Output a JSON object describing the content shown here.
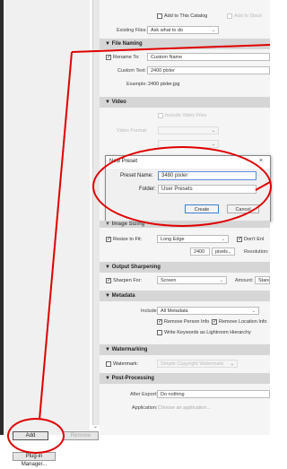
{
  "file_settings": {
    "add_catalog_label": "Add to This Catalog",
    "add_stack_label": "Add to Stack",
    "existing_files_label": "Existing Files:",
    "existing_files_value": "Ask what to do"
  },
  "file_naming": {
    "header": "File Naming",
    "rename_label": "Rename To:",
    "rename_value": "Custom Name",
    "custom_text_label": "Custom Text:",
    "custom_text_value": "2400 pixler",
    "example_label": "Example:",
    "example_value": "2400 pixler.jpg"
  },
  "video": {
    "header": "Video",
    "include_label": "Include Video Files",
    "format_label": "Video Format:"
  },
  "dialog": {
    "title": "New Preset",
    "close": "×",
    "preset_name_label": "Preset Name:",
    "preset_name_value": "3480 pixler",
    "folder_label": "Folder:",
    "folder_value": "User Presets",
    "create": "Create",
    "cancel": "Cancel"
  },
  "image_sizing": {
    "header": "Image Sizing",
    "resize_label": "Resize to Fit:",
    "resize_value": "Long Edge",
    "dont_enlarge": "Don't Enl",
    "size_value": "2400",
    "unit_value": "pixels",
    "resolution_label": "Resolution:"
  },
  "output_sharpening": {
    "header": "Output Sharpening",
    "sharpen_label": "Sharpen For:",
    "sharpen_value": "Screen",
    "amount_label": "Amount:",
    "amount_value": "Stand"
  },
  "metadata": {
    "header": "Metadata",
    "include_label": "Include:",
    "include_value": "All Metadata",
    "remove_person": "Remove Person Info",
    "remove_location": "Remove Location Info",
    "write_keywords": "Write Keywords as Lightroom Hierarchy"
  },
  "watermarking": {
    "header": "Watermarking",
    "watermark_label": "Watermark:",
    "watermark_value": "Simple Copyright Watermark"
  },
  "post_processing": {
    "header": "Post-Processing",
    "after_export_label": "After Export:",
    "after_export_value": "Do nothing",
    "application_label": "Application:",
    "application_value": "Choose an application..."
  },
  "bottom": {
    "add": "Add",
    "remove": "Remove",
    "plugin_manager": "Plug-in Manager..."
  },
  "colors": {
    "annotation": "#e00000"
  }
}
